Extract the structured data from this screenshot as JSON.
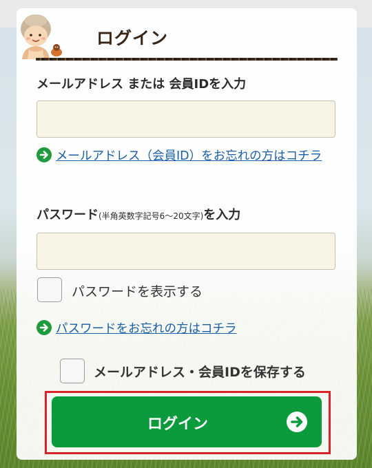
{
  "header": {
    "title": "ログイン"
  },
  "email": {
    "label": "メールアドレス または 会員IDを入力",
    "value": "",
    "placeholder": "",
    "forgot_link": "メールアドレス（会員ID）をお忘れの方はコチラ"
  },
  "password": {
    "label_main": "パスワード",
    "label_note": "(半角英数字記号6～20文字)",
    "label_suffix": "を入力",
    "value": "",
    "placeholder": "",
    "show_password_label": "パスワードを表示する",
    "forgot_link": "パスワードをお忘れの方はコチラ"
  },
  "remember": {
    "label": "メールアドレス・会員IDを保存する"
  },
  "login_button": {
    "label": "ログイン"
  },
  "colors": {
    "accent_green": "#0b9a3c",
    "link_blue": "#1a5fa8",
    "highlight_red": "#d8232a",
    "input_bg": "#f8f5e6"
  },
  "icons": {
    "link_arrow": "arrow-right-circle-icon",
    "button_arrow": "arrow-right-circle-icon",
    "mascot": "farmer-mascot-icon"
  }
}
